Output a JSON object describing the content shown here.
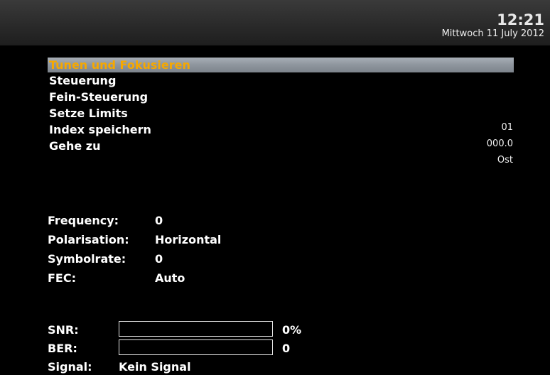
{
  "header": {
    "time": "12:21",
    "date": "Mittwoch 11 July 2012"
  },
  "menu": {
    "items": [
      {
        "label": "Tunen und Fokusieren",
        "selected": true
      },
      {
        "label": "Steuerung"
      },
      {
        "label": "Fein-Steuerung"
      },
      {
        "label": "Setze Limits"
      },
      {
        "label": "Index speichern",
        "value": "01"
      },
      {
        "label": "Gehe zu",
        "value": "000.0"
      }
    ],
    "direction": "Ost"
  },
  "tuner": {
    "frequency_label": "Frequency:",
    "frequency_value": "0",
    "polarisation_label": "Polarisation:",
    "polarisation_value": "Horizontal",
    "symbolrate_label": "Symbolrate:",
    "symbolrate_value": "0",
    "fec_label": "FEC:",
    "fec_value": "Auto"
  },
  "signal": {
    "snr_label": "SNR:",
    "snr_value": "0%",
    "snr_fraction": 0,
    "ber_label": "BER:",
    "ber_value": "0",
    "ber_fraction": 0,
    "signal_label": "Signal:",
    "signal_value": "Kein Signal"
  },
  "colors": {
    "highlight_text": "#f6a800",
    "highlight_bar": "#8e959d",
    "background": "#000000"
  }
}
